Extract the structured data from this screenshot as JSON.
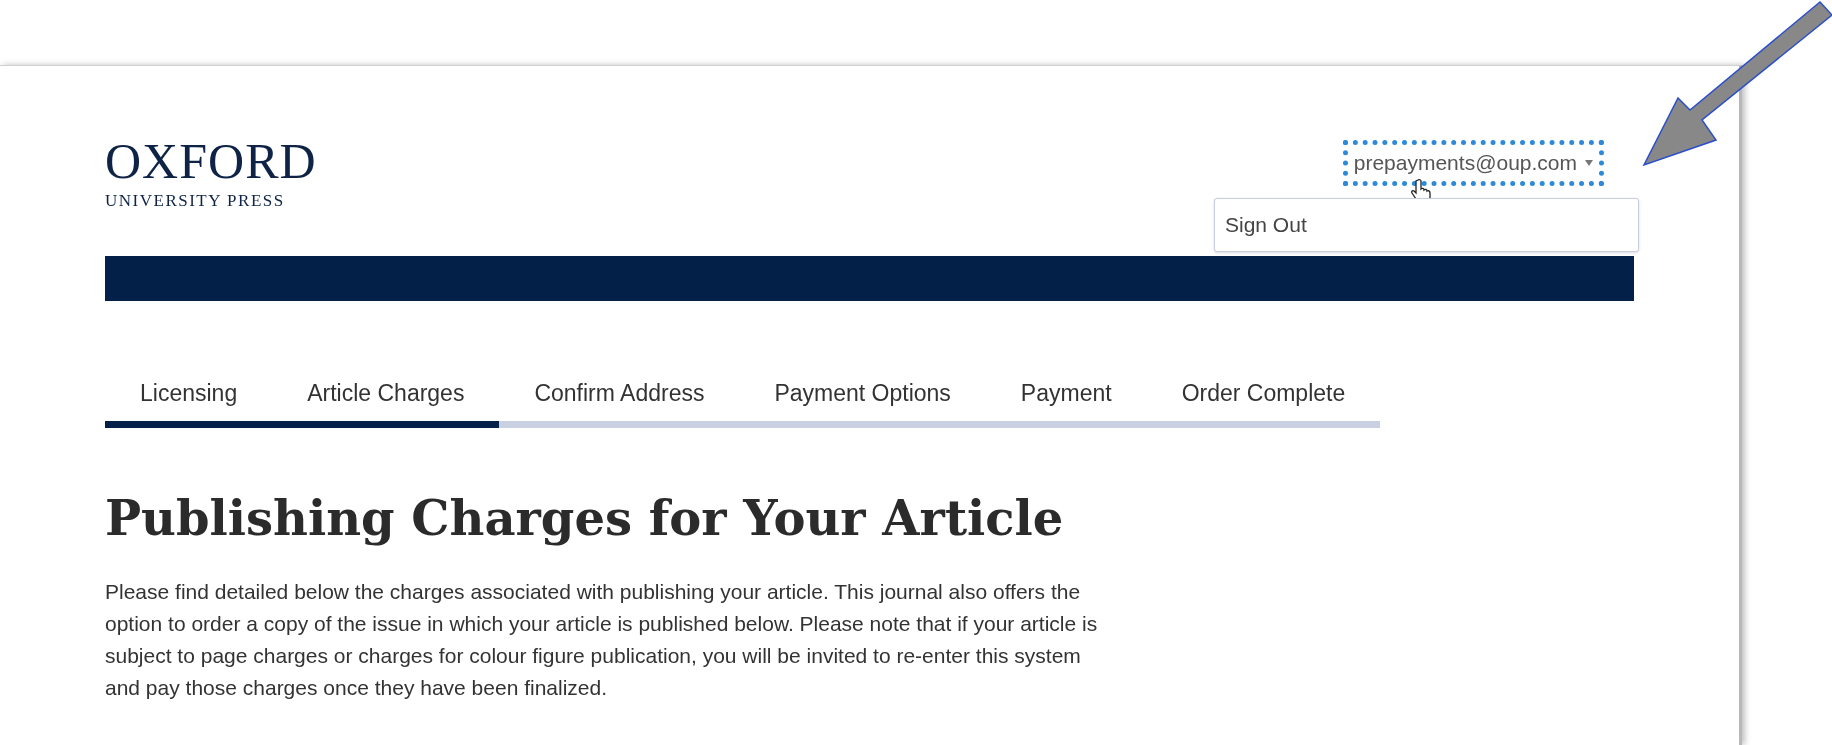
{
  "logo": {
    "name": "OXFORD",
    "subtitle": "UNIVERSITY PRESS"
  },
  "account_menu": {
    "label": "prepayments@oup.com",
    "expanded": true,
    "items": [
      "Sign Out"
    ]
  },
  "steps": [
    {
      "label": "Licensing",
      "completed": true
    },
    {
      "label": "Article Charges",
      "completed": true
    },
    {
      "label": "Confirm Address",
      "completed": false
    },
    {
      "label": "Payment Options",
      "completed": false
    },
    {
      "label": "Payment",
      "completed": false
    },
    {
      "label": "Order Complete",
      "completed": false
    }
  ],
  "heading": "Publishing Charges for Your Article",
  "intro": "Please find detailed below the charges associated with publishing your article. This journal also offers the option to order a copy of the issue in which your article is published below. Please note that if your article is subject to page charges or charges for colour figure publication, you will be invited to re-enter this system and pay those charges once they have been finalized."
}
